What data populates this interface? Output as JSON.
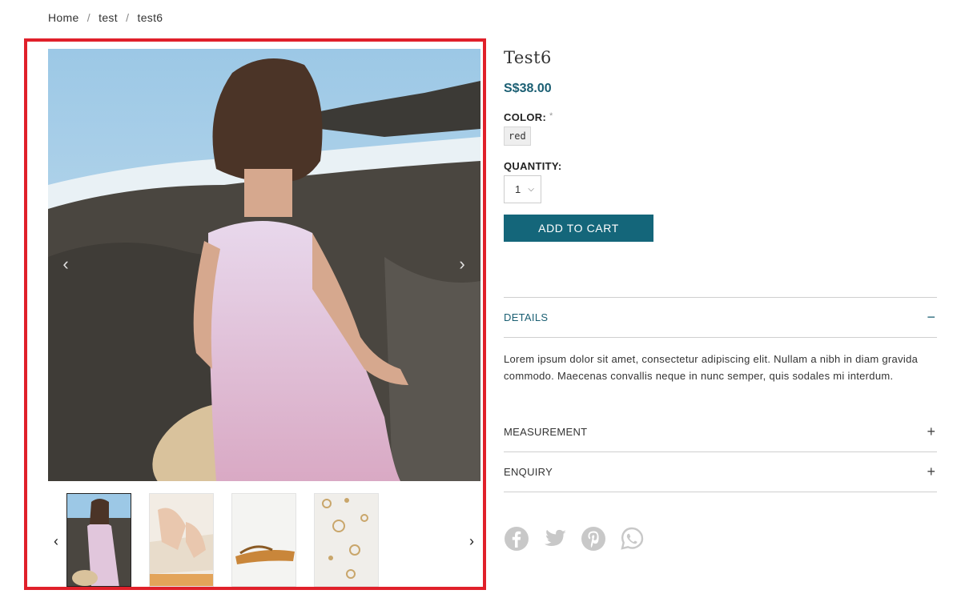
{
  "breadcrumb": {
    "items": [
      "Home",
      "test",
      "test6"
    ],
    "separator": "/"
  },
  "gallery": {
    "main_image_alt": "woman in pink dress on beach rocks",
    "thumbnails": [
      {
        "alt": "pink dress",
        "active": true
      },
      {
        "alt": "hands pressing dough",
        "active": false
      },
      {
        "alt": "sandals",
        "active": false
      },
      {
        "alt": "earrings",
        "active": false
      }
    ],
    "prev_icon": "chevron-left-icon",
    "next_icon": "chevron-right-icon"
  },
  "product": {
    "title": "Test6",
    "price": "S$38.00",
    "color_label": "COLOR:",
    "required_mark": "*",
    "color_option": "red",
    "quantity_label": "QUANTITY:",
    "quantity_value": "1",
    "add_to_cart": "ADD TO CART"
  },
  "accordion": {
    "details_title": "DETAILS",
    "details_sign": "−",
    "details_body": "Lorem ipsum dolor sit amet, consectetur adipiscing elit. Nullam a nibh in diam gravida commodo. Maecenas convallis neque in nunc semper, quis sodales mi interdum.",
    "measurement_title": "MEASUREMENT",
    "measurement_sign": "+",
    "enquiry_title": "ENQUIRY",
    "enquiry_sign": "+"
  },
  "colors": {
    "accent": "#14667a",
    "price": "#1b5f73",
    "highlight": "#e0202a",
    "social": "#c8c8c8"
  },
  "social": [
    "facebook-icon",
    "twitter-icon",
    "pinterest-icon",
    "whatsapp-icon"
  ]
}
